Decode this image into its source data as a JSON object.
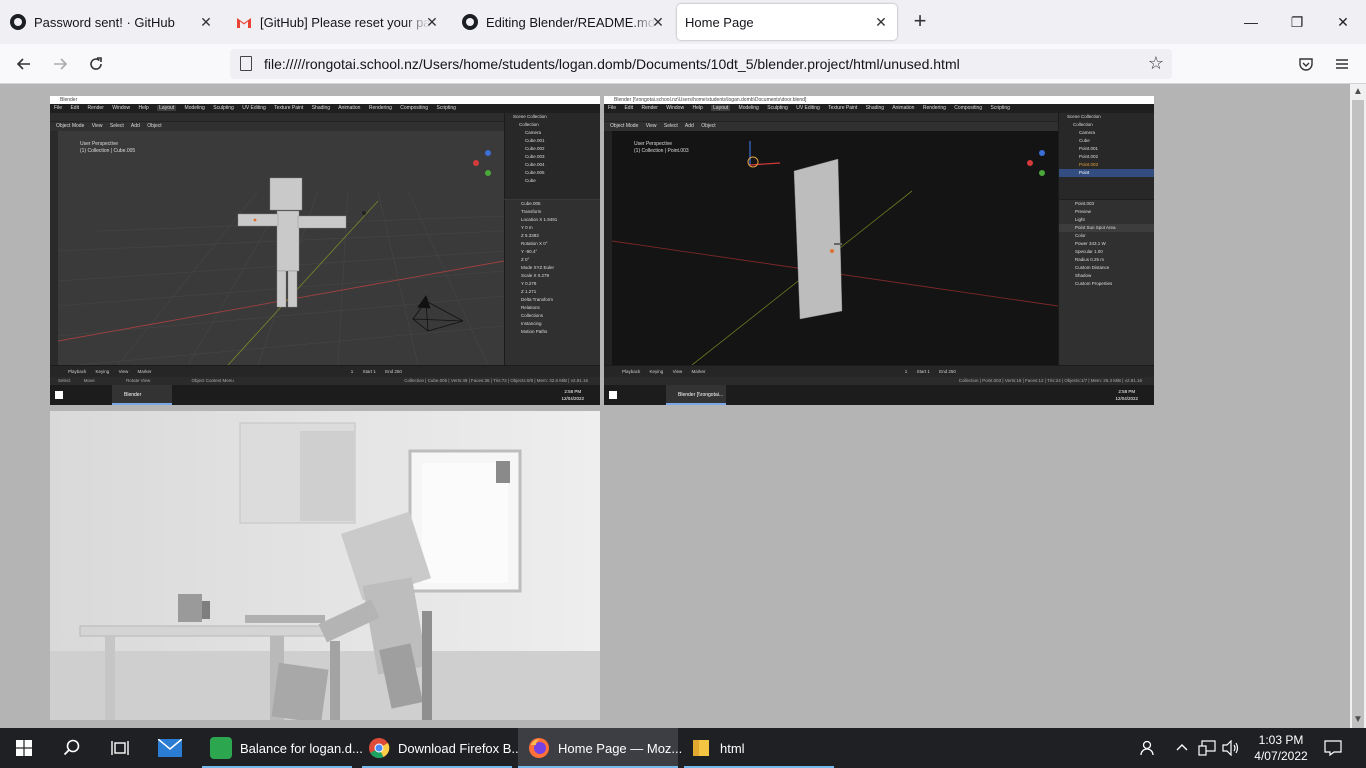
{
  "browser": {
    "tabs": [
      {
        "title": "Password sent! · GitHub",
        "icon": "github-icon",
        "active": false
      },
      {
        "title": "[GitHub] Please reset your password",
        "icon": "gmail-icon",
        "active": false
      },
      {
        "title": "Editing Blender/README.md at",
        "icon": "github-icon",
        "active": false
      },
      {
        "title": "Home Page",
        "icon": "none",
        "active": true
      }
    ],
    "new_tab_glyph": "+",
    "url": "file://///rongotai.school.nz/Users/home/students/logan.domb/Documents/10dt_5/blender.project/html/unused.html",
    "window_controls": {
      "minimize": "—",
      "restore": "❐",
      "close": "✕"
    }
  },
  "screenshot_left": {
    "title": "Blender",
    "menus": [
      "File",
      "Edit",
      "Render",
      "Window",
      "Help"
    ],
    "workspaces": [
      "Layout",
      "Modeling",
      "Sculpting",
      "UV Editing",
      "Texture Paint",
      "Shading",
      "Animation",
      "Rendering",
      "Compositing",
      "Scripting"
    ],
    "active_workspace": "Layout",
    "mode_items": [
      "Object Mode",
      "View",
      "Select",
      "Add",
      "Object"
    ],
    "viewport_label": [
      "User Perspective",
      "(1) Collection | Cube.005"
    ],
    "outliner": [
      "Scene Collection",
      "Collection",
      "Camera",
      "Cube.001",
      "Cube.002",
      "Cube.003",
      "Cube.004",
      "Cube.005",
      "Cube"
    ],
    "props": [
      "Cube.005",
      "Transform",
      "Location X  1.9491",
      "Y  0 m",
      "Z  5.3383",
      "Rotation X  0°",
      "Y  -90.4°",
      "Z  0°",
      "Mode  XYZ Euler",
      "Scale X  0.279",
      "Y  0.279",
      "Z  1.271",
      "Delta Transform",
      "Relations",
      "Collections",
      "Instancing",
      "Motion Paths"
    ],
    "timeline": [
      "Playback",
      "Keying",
      "View",
      "Marker",
      "1",
      "Start 1",
      "End 250"
    ],
    "status_left": [
      "Select",
      "Move",
      "Rotate View",
      "Object Context Menu"
    ],
    "status_right": "Collection | Cube.005 | Verts:48 | Faces:36 | Tris:72 | Objects:0/8 | Mem: 32.6 MiB | v2.81.16",
    "taskbar_app": "Blender",
    "clock": [
      "2:58 PM",
      "12/04/2022"
    ]
  },
  "screenshot_right": {
    "title": "Blender [\\\\rongotai.school.nz\\Users\\home\\students\\logan.domb\\Documents\\door.blend]",
    "menus": [
      "File",
      "Edit",
      "Render",
      "Window",
      "Help"
    ],
    "workspaces": [
      "Layout",
      "Modeling",
      "Sculpting",
      "UV Editing",
      "Texture Paint",
      "Shading",
      "Animation",
      "Rendering",
      "Compositing",
      "Scripting"
    ],
    "active_workspace": "Layout",
    "mode_items": [
      "Object Mode",
      "View",
      "Select",
      "Add",
      "Object"
    ],
    "viewport_label": [
      "User Perspective",
      "(1) Collection | Point.003"
    ],
    "outliner": [
      "Scene Collection",
      "Collection",
      "Camera",
      "Cube",
      "Point.001",
      "Point.002",
      "Point.003",
      "Point"
    ],
    "props": [
      "Point.003",
      "Preview",
      "Light",
      "Point  Sun  Spot  Area",
      "Color",
      "Power  343.1 W",
      "Specular  1.00",
      "Radius  0.25 m",
      "Custom Distance",
      "Shadow",
      "Custom Properties"
    ],
    "timeline": [
      "Playback",
      "Keying",
      "View",
      "Marker",
      "1",
      "Start 1",
      "End 250"
    ],
    "status_right": "Collection | Point.003 | Verts:18 | Faces:12 | Tris:24 | Objects:1/7 | Mem: 26.3 MiB | v2.81.16",
    "taskbar_app": "Blender [\\\\rongotai...",
    "clock": [
      "2:58 PM",
      "12/04/2022"
    ]
  },
  "render_image": {
    "description_icon": "render-image"
  },
  "taskbar": {
    "items": [
      {
        "label": "Balance for logan.d...",
        "icon": "balance-app-icon",
        "color": "#2ca64f"
      },
      {
        "label": "Download Firefox B...",
        "icon": "chrome-icon",
        "color": "#dd4b39"
      },
      {
        "label": "Home Page — Moz...",
        "icon": "firefox-icon",
        "color": "#ff7139"
      },
      {
        "label": "html",
        "icon": "folder-icon",
        "color": "#f4c542"
      }
    ],
    "time": "1:03 PM",
    "date": "4/07/2022"
  }
}
